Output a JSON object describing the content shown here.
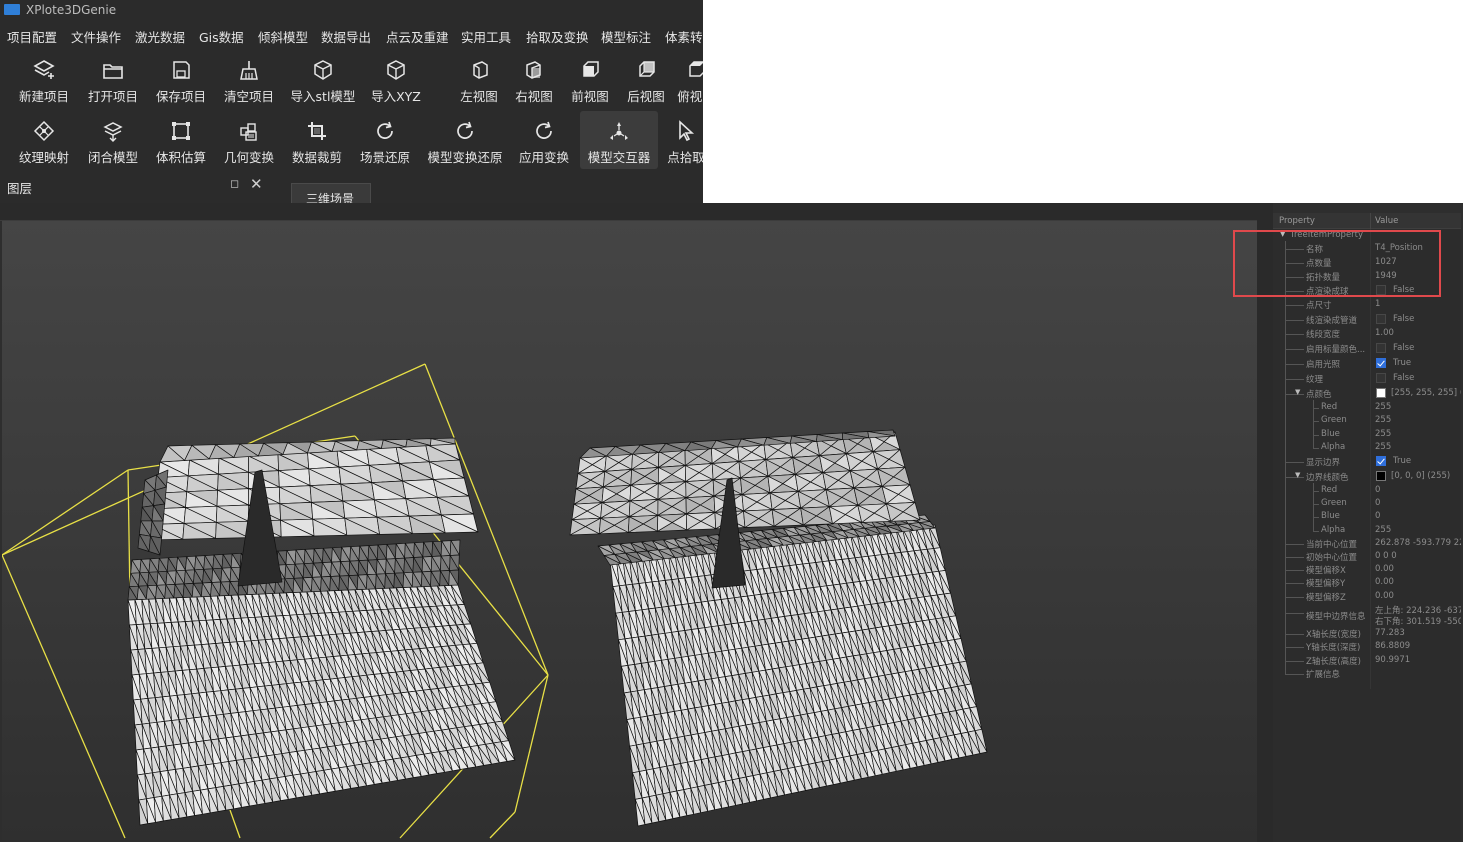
{
  "app": {
    "title": "XPlote3DGenie",
    "menu": [
      "项目配置",
      "文件操作",
      "激光数据",
      "Gis数据",
      "倾斜模型",
      "数据导出",
      "点云及重建",
      "实用工具",
      "拾取及变换",
      "模型标注",
      "体素转换"
    ],
    "toolbar_row1": [
      {
        "label": "新建项目",
        "icon": "layers-add-icon"
      },
      {
        "label": "打开项目",
        "icon": "folder-open-icon"
      },
      {
        "label": "保存项目",
        "icon": "save-icon"
      },
      {
        "label": "清空项目",
        "icon": "broom-icon"
      },
      {
        "label": "导入stl模型",
        "icon": "cube-icon"
      },
      {
        "label": "导入XYZ",
        "icon": "cube-icon"
      },
      {
        "label": "左视图",
        "icon": "cube-left-icon"
      },
      {
        "label": "右视图",
        "icon": "cube-right-icon"
      },
      {
        "label": "前视图",
        "icon": "cube-front-icon"
      },
      {
        "label": "后视图",
        "icon": "cube-back-icon"
      },
      {
        "label": "俯视图",
        "icon": "cube-top-icon"
      }
    ],
    "toolbar_row2": [
      {
        "label": "纹理映射",
        "icon": "texture-icon"
      },
      {
        "label": "闭合模型",
        "icon": "layers-merge-icon"
      },
      {
        "label": "体积估算",
        "icon": "bounding-square-icon"
      },
      {
        "label": "几何变换",
        "icon": "transform-icon"
      },
      {
        "label": "数据裁剪",
        "icon": "crop-icon"
      },
      {
        "label": "场景还原",
        "icon": "refresh-icon"
      },
      {
        "label": "模型变换还原",
        "icon": "refresh-icon"
      },
      {
        "label": "应用变换",
        "icon": "refresh-icon"
      },
      {
        "label": "模型交互器",
        "icon": "interactor-icon",
        "active": true
      },
      {
        "label": "点拾取",
        "icon": "pointer-icon"
      }
    ],
    "layer_panel_title": "图层",
    "scene_tab": "三维场景"
  },
  "properties": {
    "header_property": "Property",
    "header_value": "Value",
    "root": "TreeItemProperty",
    "rows": [
      {
        "name": "名称",
        "value": "T4_Position",
        "type": "text"
      },
      {
        "name": "点数量",
        "value": "1027",
        "type": "text"
      },
      {
        "name": "拓扑数量",
        "value": "1949",
        "type": "text"
      },
      {
        "name": "点渲染成球",
        "value": "False",
        "type": "bool",
        "checked": false
      },
      {
        "name": "点尺寸",
        "value": "1",
        "type": "text"
      },
      {
        "name": "线渲染成管道",
        "value": "False",
        "type": "bool",
        "checked": false
      },
      {
        "name": "线段宽度",
        "value": "1.00",
        "type": "text"
      },
      {
        "name": "启用标量颜色...",
        "value": "False",
        "type": "bool",
        "checked": false
      },
      {
        "name": "启用光照",
        "value": "True",
        "type": "bool",
        "checked": true
      },
      {
        "name": "纹理",
        "value": "False",
        "type": "bool",
        "checked": false
      },
      {
        "name": "点颜色",
        "value": "[255, 255, 255] (2...",
        "type": "color",
        "color": "#ffffff",
        "expanded": true
      },
      {
        "name": "Red",
        "value": "255",
        "type": "sub"
      },
      {
        "name": "Green",
        "value": "255",
        "type": "sub"
      },
      {
        "name": "Blue",
        "value": "255",
        "type": "sub"
      },
      {
        "name": "Alpha",
        "value": "255",
        "type": "sub"
      },
      {
        "name": "显示边界",
        "value": "True",
        "type": "bool",
        "checked": true
      },
      {
        "name": "边界线颜色",
        "value": "[0, 0, 0] (255)",
        "type": "color",
        "color": "#000000",
        "expanded": true
      },
      {
        "name": "Red",
        "value": "0",
        "type": "sub"
      },
      {
        "name": "Green",
        "value": "0",
        "type": "sub"
      },
      {
        "name": "Blue",
        "value": "0",
        "type": "sub"
      },
      {
        "name": "Alpha",
        "value": "255",
        "type": "sub"
      },
      {
        "name": "当前中心位置",
        "value": "262.878 -593.779 22...",
        "type": "text"
      },
      {
        "name": "初始中心位置",
        "value": "0 0 0",
        "type": "text"
      },
      {
        "name": "模型偏移X",
        "value": "0.00",
        "type": "text"
      },
      {
        "name": "模型偏移Y",
        "value": "0.00",
        "type": "text"
      },
      {
        "name": "模型偏移Z",
        "value": "0.00",
        "type": "text"
      },
      {
        "name": "模型中边界信息",
        "value": "左上角: 224.236 -637...",
        "value2": "右下角: 301.519 -550...",
        "type": "double"
      },
      {
        "name": "X轴长度(宽度)",
        "value": "77.283",
        "type": "text"
      },
      {
        "name": "Y轴长度(深度)",
        "value": "86.8809",
        "type": "text"
      },
      {
        "name": "Z轴长度(高度)",
        "value": "90.9971",
        "type": "text"
      },
      {
        "name": "扩展信息",
        "value": "",
        "type": "text"
      }
    ]
  },
  "colors": {
    "app_bg": "#2b2b2b",
    "viewport_bg_top": "#444444",
    "viewport_bg_bottom": "#303030",
    "bbox": "#e8e046",
    "mesh_fill": "#e6e6e6",
    "mesh_edge": "#111111",
    "highlight": "#e0494c",
    "check_on": "#2f6fdb"
  }
}
